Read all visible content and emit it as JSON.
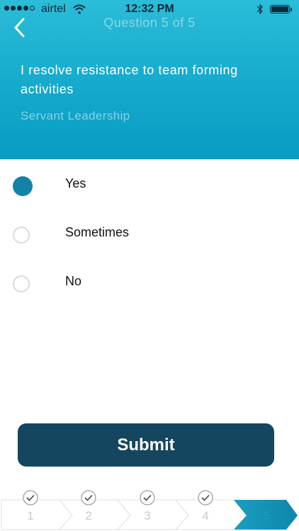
{
  "status_bar": {
    "carrier": "airtel",
    "time": "12:32 PM",
    "icons": [
      "signal-dots-icon",
      "wifi-icon",
      "bluetooth-icon",
      "battery-icon"
    ]
  },
  "nav": {
    "back_icon": "chevron-left-icon",
    "title": "Question 5 of 5"
  },
  "question": {
    "text": "I resolve resistance to team forming activities",
    "category": "Servant Leadership"
  },
  "options": [
    {
      "label": "Yes",
      "selected": true
    },
    {
      "label": "Sometimes",
      "selected": false
    },
    {
      "label": "No",
      "selected": false
    }
  ],
  "submit_label": "Submit",
  "progress": {
    "steps": [
      {
        "label": "1",
        "completed": true
      },
      {
        "label": "2",
        "completed": true
      },
      {
        "label": "3",
        "completed": true
      },
      {
        "label": "4",
        "completed": true
      },
      {
        "label": "5",
        "completed": false,
        "current": true
      }
    ]
  },
  "colors": {
    "header_gradient_top": "#2bbcd8",
    "header_gradient_bottom": "#0a9cc3",
    "accent": "#1282a8",
    "submit_bg": "#154660",
    "active_step": "#0f86ab"
  }
}
